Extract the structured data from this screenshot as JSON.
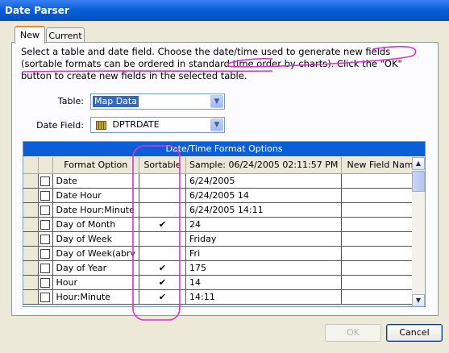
{
  "window": {
    "title": "Date Parser"
  },
  "tabs": [
    {
      "label": "New"
    },
    {
      "label": "Current"
    }
  ],
  "instructions": "Select a table and date field.  Choose the date/time used to generate new fields (sortable formats can be ordered in standard time order by charts). Click the \"OK\" button to create new fields in the selected table.",
  "table_field": {
    "label": "Table:",
    "value": "Map Data"
  },
  "date_field": {
    "label": "Date Field:",
    "value": "DPTRDATE"
  },
  "grid": {
    "title": "Date/Time Format Options",
    "columns": [
      "Format Option",
      "Sortable",
      "Sample: 06/24/2005 02:11:57 PM",
      "New Field Name"
    ],
    "rows": [
      {
        "format": "Date",
        "sortable": "",
        "sample": "6/24/2005",
        "name": ""
      },
      {
        "format": "Date Hour",
        "sortable": "",
        "sample": "6/24/2005 14",
        "name": ""
      },
      {
        "format": "Date Hour:Minute",
        "sortable": "",
        "sample": "6/24/2005 14:11",
        "name": ""
      },
      {
        "format": "Day of Month",
        "sortable": "✔",
        "sample": "24",
        "name": ""
      },
      {
        "format": "Day of Week",
        "sortable": "",
        "sample": "Friday",
        "name": ""
      },
      {
        "format": "Day of Week(abrv",
        "sortable": "",
        "sample": "Fri",
        "name": ""
      },
      {
        "format": "Day of Year",
        "sortable": "✔",
        "sample": "175",
        "name": ""
      },
      {
        "format": "Hour",
        "sortable": "✔",
        "sample": "14",
        "name": ""
      },
      {
        "format": "Hour:Minute",
        "sortable": "✔",
        "sample": "14:11",
        "name": ""
      }
    ]
  },
  "buttons": {
    "ok": "OK",
    "cancel": "Cancel"
  },
  "colors": {
    "titlebar": "#0a5fd8",
    "annotation": "#e030d0"
  }
}
